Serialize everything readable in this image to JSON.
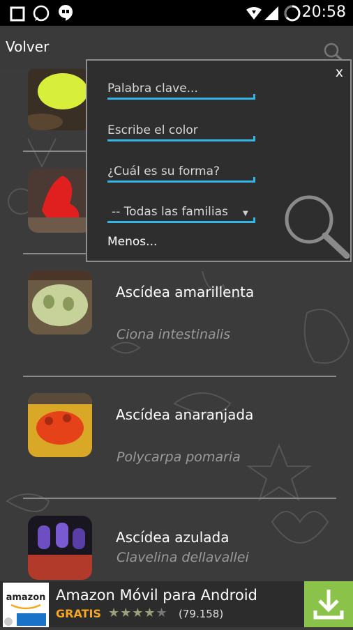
{
  "status_bar": {
    "time": "20:58"
  },
  "action_bar": {
    "back_label": "Volver"
  },
  "popup": {
    "close_label": "x",
    "keyword_placeholder": "Palabra clave...",
    "color_placeholder": "Escribe el color",
    "shape_placeholder": "¿Cuál es su forma?",
    "family_selected": "-- Todas las familias",
    "less_label": "Menos..."
  },
  "list": {
    "items": [
      {
        "name": "",
        "scientific": ""
      },
      {
        "name": "",
        "scientific": ""
      },
      {
        "name": "Ascídea amarillenta",
        "scientific": "Ciona intestinalis"
      },
      {
        "name": "Ascídea anaranjada",
        "scientific": "Polycarpa pomaria"
      },
      {
        "name": "Ascídea azulada",
        "scientific": "Clavelina dellavallei"
      }
    ]
  },
  "ad": {
    "logo_text": "amazon",
    "title": "Amazon Móvil para Android",
    "price": "GRATIS",
    "rating": 4,
    "rating_count": "(79.158)",
    "colors": {
      "price": "#f5a623",
      "download_bg": "#8bc34a"
    }
  }
}
